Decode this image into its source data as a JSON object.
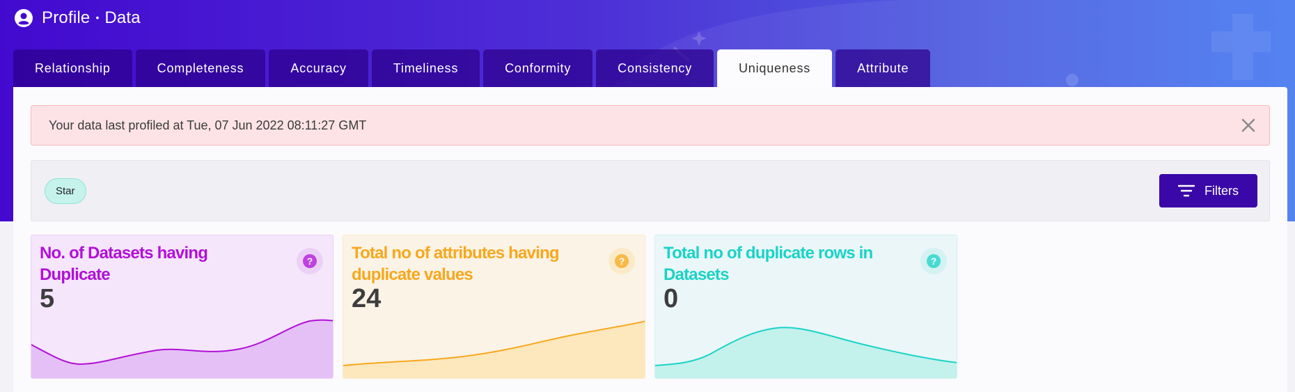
{
  "header": {
    "title": "Profile",
    "subtitle": "Data",
    "separator": "•"
  },
  "tabs": [
    {
      "label": "Relationship",
      "active": false
    },
    {
      "label": "Completeness",
      "active": false
    },
    {
      "label": "Accuracy",
      "active": false
    },
    {
      "label": "Timeliness",
      "active": false
    },
    {
      "label": "Conformity",
      "active": false
    },
    {
      "label": "Consistency",
      "active": false
    },
    {
      "label": "Uniqueness",
      "active": true
    },
    {
      "label": "Attribute",
      "active": false
    }
  ],
  "alert": {
    "message": "Your data last profiled at Tue, 07 Jun 2022 08:11:27 GMT",
    "close_icon": "close-icon"
  },
  "filterbar": {
    "chip_label": "Star",
    "filters_label": "Filters",
    "filters_icon": "filter-icon"
  },
  "cards": [
    {
      "label": "No. of Datasets having Duplicate",
      "value": "5",
      "color": "#b110d8",
      "bg": "#f5e6fb",
      "help_bg": "#ecd1f6",
      "fill": "#e5c0f6",
      "icon": "help-icon"
    },
    {
      "label": "Total no of attributes having duplicate values",
      "value": "24",
      "color": "#f7a81d",
      "bg": "#faf3e6",
      "help_bg": "#faeac8",
      "fill": "#fde7bc",
      "icon": "help-icon"
    },
    {
      "label": "Total no of duplicate rows in Datasets",
      "value": "0",
      "color": "#1ad3c6",
      "bg": "#eaf6f8",
      "help_bg": "#d4f2f1",
      "fill": "#c3f1ec",
      "icon": "help-icon"
    }
  ],
  "colors": {
    "hero_start": "#4309cf",
    "hero_end": "#4a7cf0",
    "tab_bg": "#2d008c",
    "button": "#3a07a8",
    "alert_bg": "#fde3e6",
    "chip_bg": "#c5f3ec"
  }
}
